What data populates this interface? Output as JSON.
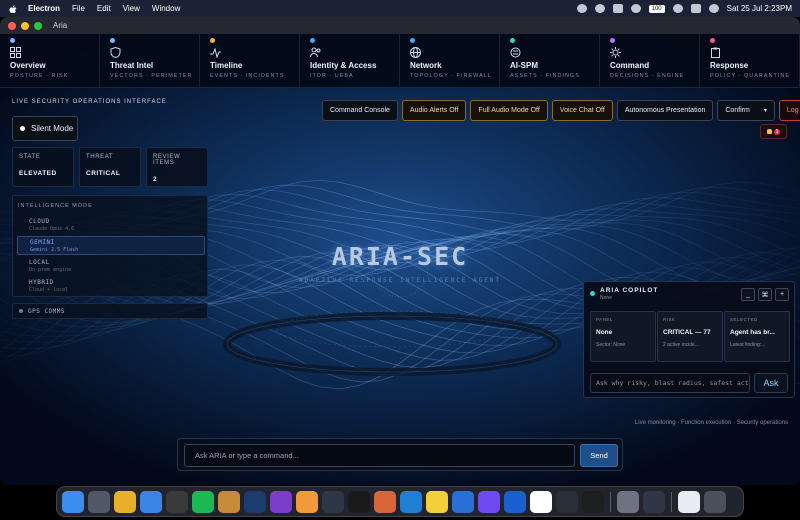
{
  "menubar": {
    "app": "Electron",
    "items": [
      "File",
      "Edit",
      "View",
      "Window"
    ],
    "battery": "100",
    "datetime": "Sat 25 Jul  2:23PM"
  },
  "window": {
    "title": "Aria"
  },
  "nav": [
    {
      "label": "Overview",
      "sub": "POSTURE · RISK",
      "dot": "#7ab8ff",
      "icon": "grid-icon"
    },
    {
      "label": "Threat Intel",
      "sub": "VECTORS · PERIMETER",
      "dot": "#7ab8ff",
      "icon": "shield-icon"
    },
    {
      "label": "Timeline",
      "sub": "EVENTS · INCIDENTS",
      "dot": "#f2b340",
      "icon": "activity-icon"
    },
    {
      "label": "Identity & Access",
      "sub": "ITDR · UEBA",
      "dot": "#4fa3ff",
      "icon": "users-icon"
    },
    {
      "label": "Network",
      "sub": "TOPOLOGY · FIREWALL",
      "dot": "#4fa3ff",
      "icon": "globe-icon"
    },
    {
      "label": "AI-SPM",
      "sub": "ASSETS · FINDINGS",
      "dot": "#3dd6a8",
      "icon": "cpu-icon"
    },
    {
      "label": "Command",
      "sub": "DECISIONS · ENGINE",
      "dot": "#b07bff",
      "icon": "sun-icon"
    },
    {
      "label": "Response",
      "sub": "POLICY · QUARANTINE",
      "dot": "#ff5a7a",
      "icon": "clipboard-icon"
    }
  ],
  "section_label": "LIVE SECURITY OPERATIONS INTERFACE",
  "toolbar": {
    "command_console": "Command Console",
    "audio_alerts": "Audio Alerts Off",
    "full_audio": "Full Audio Mode Off",
    "voice_chat": "Voice Chat Off",
    "autonomous": "Autonomous Presentation",
    "confirm": "Confirm",
    "logout": "Log Out"
  },
  "silent_mode": "Silent Mode",
  "bell_count": "1",
  "state_cards": [
    {
      "key": "STATE",
      "value": "ELEVATED"
    },
    {
      "key": "THREAT",
      "value": "CRITICAL"
    },
    {
      "key": "REVIEW ITEMS",
      "value": "2"
    }
  ],
  "intelligence": {
    "header": "INTELLIGENCE MODE",
    "modes": [
      {
        "name": "CLOUD",
        "sub": "Claude Opus 4.6"
      },
      {
        "name": "GEMINI",
        "sub": "Gemini 2.5 Flash"
      },
      {
        "name": "LOCAL",
        "sub": "On-prem engine"
      },
      {
        "name": "HYBRID",
        "sub": "Cloud + local"
      }
    ],
    "active_index": 1
  },
  "gps": "GPS COMMS",
  "logo": {
    "title": "ARIA-SEC",
    "sub": "ADAPTIVE RESPONSE INTELLIGENCE AGENT"
  },
  "copilot": {
    "title": "ARIA COPILOT",
    "status": "None",
    "cards": [
      {
        "key": "PANEL",
        "value": "None",
        "sub": "Sector: None"
      },
      {
        "key": "RISK",
        "value": "CRITICAL — 77",
        "sub": "2 active incide..."
      },
      {
        "key": "SELECTED",
        "value": "Agent has br...",
        "sub": "Latest finding:..."
      }
    ],
    "input_placeholder": "Ask why risky, blast radius, safest act",
    "ask": "Ask"
  },
  "status_note": "Live monitoring · Function execution · Security operations",
  "command": {
    "placeholder": "Ask ARIA or type a command...",
    "send": "Send"
  },
  "dock": [
    {
      "name": "finder-icon",
      "color": "#3b8ef0"
    },
    {
      "name": "launchpad-icon",
      "color": "#505868"
    },
    {
      "name": "chrome-icon",
      "color": "#e8b02a"
    },
    {
      "name": "mail-icon",
      "color": "#3a86e8"
    },
    {
      "name": "calculator-icon",
      "color": "#3a3a3a"
    },
    {
      "name": "spotify-icon",
      "color": "#1db954"
    },
    {
      "name": "game-icon",
      "color": "#c78a3a"
    },
    {
      "name": "photoshop-icon",
      "color": "#1c3c70"
    },
    {
      "name": "video-icon",
      "color": "#7b3cc9"
    },
    {
      "name": "photos-icon",
      "color": "#f29a3a"
    },
    {
      "name": "electron-icon",
      "color": "#2f3747"
    },
    {
      "name": "openai-icon",
      "color": "#1a1a1a"
    },
    {
      "name": "claude-icon",
      "color": "#d9653b"
    },
    {
      "name": "vscode-icon",
      "color": "#1f7fd4"
    },
    {
      "name": "notes-icon",
      "color": "#f2d03a"
    },
    {
      "name": "qbittorrent-icon",
      "color": "#2b6fd6"
    },
    {
      "name": "proton-icon",
      "color": "#6d4af2"
    },
    {
      "name": "onepassword-icon",
      "color": "#1a5fd0"
    },
    {
      "name": "bitwarden-icon",
      "color": "#ffffff"
    },
    {
      "name": "activity-monitor-icon",
      "color": "#2a2e36"
    },
    {
      "name": "terminal-icon",
      "color": "#1e1e1e"
    },
    {
      "name": "system-settings-icon",
      "color": "#6d7380"
    },
    {
      "name": "electron-app-icon",
      "color": "#2f3747"
    }
  ]
}
